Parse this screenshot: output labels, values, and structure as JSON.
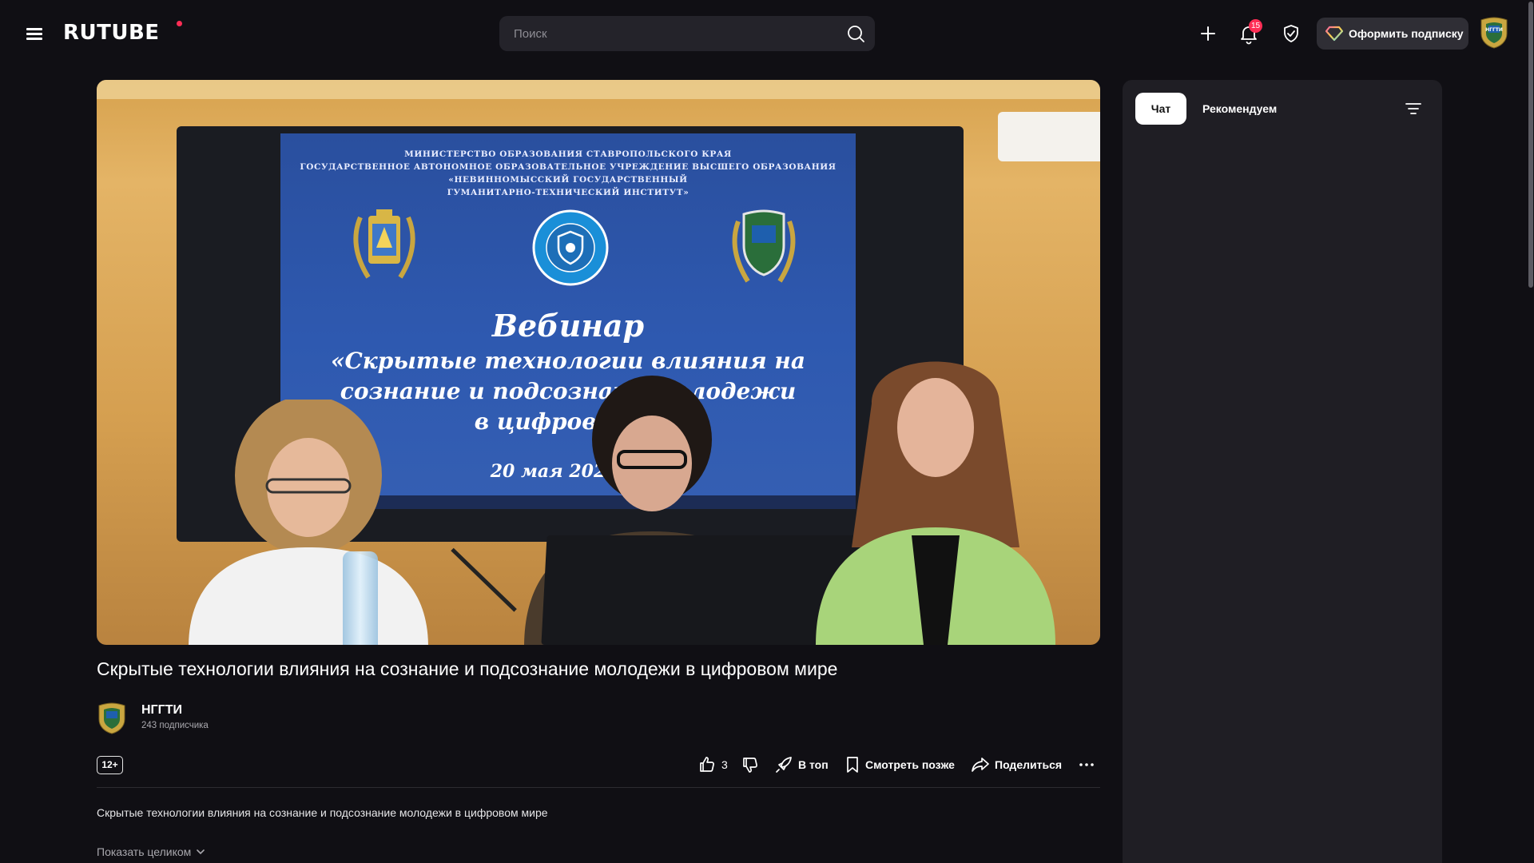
{
  "header": {
    "logo": "RUTUBE",
    "search_placeholder": "Поиск",
    "notifications_count": "15",
    "subscribe_label": "Оформить подписку"
  },
  "player": {
    "slide": {
      "line1": "МИНИСТЕРСТВО ОБРАЗОВАНИЯ СТАВРОПОЛЬСКОГО КРАЯ",
      "line2": "ГОСУДАРСТВЕННОЕ АВТОНОМНОЕ ОБРАЗОВАТЕЛЬНОЕ УЧРЕЖДЕНИЕ ВЫСШЕГО ОБРАЗОВАНИЯ",
      "line3": "«НЕВИННОМЫССКИЙ ГОСУДАРСТВЕННЫЙ",
      "line4": "ГУМАНИТАРНО-ТЕХНИЧЕСКИЙ ИНСТИТУТ»",
      "heading": "Вебинар",
      "topic1": "«Скрытые технологии влияния на",
      "topic2": "сознание и подсознани   молодежи",
      "topic3": "в цифровом м",
      "date": "20 мая 2026 го"
    }
  },
  "video": {
    "title": "Скрытые технологии влияния на сознание и подсознание молодежи в цифровом мире",
    "channel_name": "НГГТИ",
    "channel_subscribers": "243 подписчика",
    "age_rating": "12+",
    "likes": "3",
    "actions": {
      "top": "В топ",
      "watch_later": "Смотреть позже",
      "share": "Поделиться"
    },
    "description": "Скрытые технологии влияния на сознание и подсознание молодежи в цифровом мире",
    "show_more": "Показать целиком"
  },
  "side_panel": {
    "tabs": [
      {
        "label": "Чат",
        "active": true
      },
      {
        "label": "Рекомендуем",
        "active": false
      }
    ]
  },
  "colors": {
    "background": "#100f14",
    "panel": "#1f1e24",
    "accent": "#ff2d55"
  }
}
